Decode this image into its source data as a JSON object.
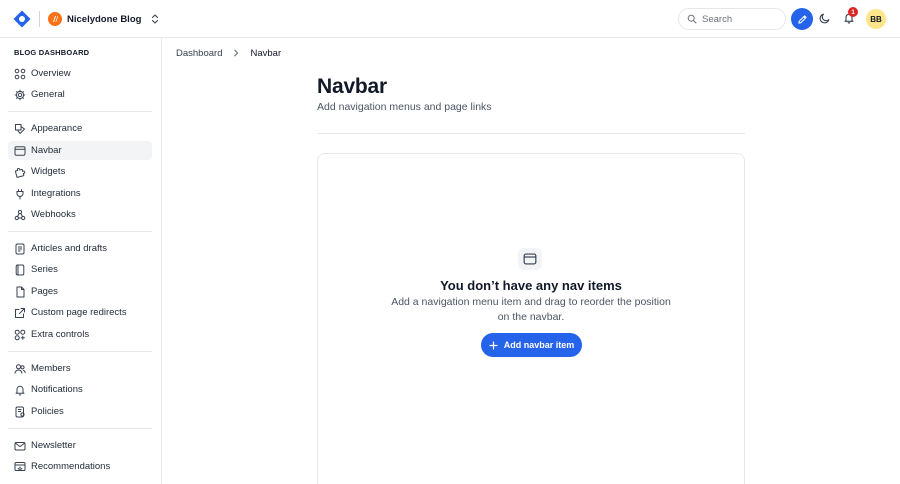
{
  "app": {
    "blog_name": "Nicelydone Blog",
    "search_placeholder": "Search",
    "notification_count": "1",
    "user_initials": "BB",
    "accent_color": "#2563eb",
    "brand_color": "#f97316",
    "icons": [
      "logo-icon",
      "blog-logo-icon",
      "chevron-updown-icon",
      "search-icon",
      "pen-icon",
      "moon-icon",
      "bell-icon"
    ]
  },
  "sidebar": {
    "heading": "BLOG DASHBOARD",
    "items": [
      {
        "label": "Overview",
        "icon": "grid-icon"
      },
      {
        "label": "General",
        "icon": "gear-icon"
      },
      {
        "label": "Appearance",
        "icon": "paint-icon"
      },
      {
        "label": "Navbar",
        "icon": "browser-window-icon",
        "active": true
      },
      {
        "label": "Widgets",
        "icon": "puzzle-icon"
      },
      {
        "label": "Integrations",
        "icon": "plug-icon"
      },
      {
        "label": "Webhooks",
        "icon": "webhook-icon"
      },
      {
        "label": "Articles and drafts",
        "icon": "document-icon"
      },
      {
        "label": "Series",
        "icon": "book-icon"
      },
      {
        "label": "Pages",
        "icon": "pages-icon"
      },
      {
        "label": "Custom page redirects",
        "icon": "external-link-icon"
      },
      {
        "label": "Extra controls",
        "icon": "controls-icon"
      },
      {
        "label": "Members",
        "icon": "users-icon"
      },
      {
        "label": "Notifications",
        "icon": "bell-icon"
      },
      {
        "label": "Policies",
        "icon": "policy-icon"
      },
      {
        "label": "Newsletter",
        "icon": "mail-icon"
      },
      {
        "label": "Recommendations",
        "icon": "recommend-icon"
      }
    ]
  },
  "breadcrumb": {
    "root": "Dashboard",
    "current": "Navbar"
  },
  "main": {
    "title": "Navbar",
    "subtitle": "Add navigation menus and page links",
    "empty_title": "You don’t have any nav items",
    "empty_desc": "Add a navigation menu item and drag to reorder the position on the navbar.",
    "add_button": "Add navbar item"
  }
}
